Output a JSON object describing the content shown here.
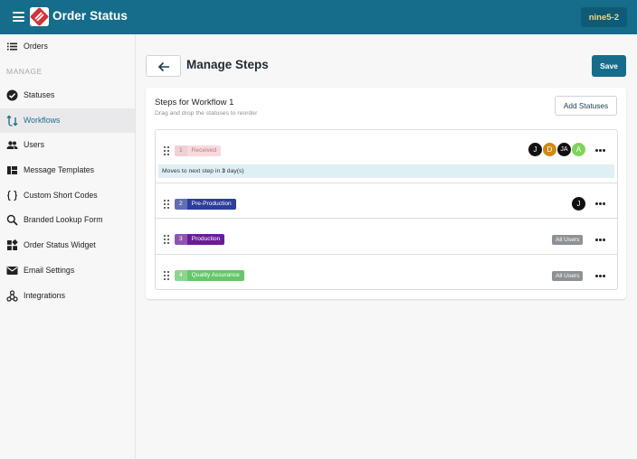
{
  "app": {
    "title": "Order Status",
    "account": "nine5-2"
  },
  "colors": {
    "brand": "#166d8b",
    "accent_red": "#d13438"
  },
  "sidebar": {
    "section_label": "MANAGE",
    "items": [
      {
        "label": "Orders",
        "icon": "list-icon"
      },
      {
        "label": "Statuses",
        "icon": "check-circle-icon"
      },
      {
        "label": "Workflows",
        "icon": "workflow-icon"
      },
      {
        "label": "Users",
        "icon": "users-icon"
      },
      {
        "label": "Message Templates",
        "icon": "template-icon"
      },
      {
        "label": "Custom Short Codes",
        "icon": "braces-icon"
      },
      {
        "label": "Branded Lookup Form",
        "icon": "search-icon"
      },
      {
        "label": "Order Status Widget",
        "icon": "widget-icon"
      },
      {
        "label": "Email Settings",
        "icon": "mail-icon"
      },
      {
        "label": "Integrations",
        "icon": "integrations-icon"
      }
    ],
    "active": "Workflows"
  },
  "page": {
    "title": "Manage Steps",
    "save_label": "Save",
    "back_icon": "arrow-left-icon"
  },
  "card": {
    "title": "Steps for Workflow 1",
    "subtitle": "Drag and drop the statuses to reorder",
    "add_label": "Add Statuses"
  },
  "steps": [
    {
      "num": "1",
      "name": "Received",
      "color": "#f9d9dd",
      "text_color": "#b07b82",
      "avatars": [
        {
          "initial": "J",
          "color": "#111111"
        },
        {
          "initial": "D",
          "color": "#d08a14"
        },
        {
          "initial": "JA",
          "color": "#111111"
        },
        {
          "initial": "A",
          "color": "#7fd35a"
        }
      ],
      "info_prefix": "Moves to next step in ",
      "info_value": "3",
      "info_suffix": " day(s)"
    },
    {
      "num": "2",
      "name": "Pre-Production",
      "color": "#2c3e9a",
      "text_color": "#ffffff",
      "avatars": [
        {
          "initial": "J",
          "color": "#111111"
        }
      ]
    },
    {
      "num": "3",
      "name": "Production",
      "color": "#6a1b9a",
      "text_color": "#ffffff",
      "all_users": "All Users"
    },
    {
      "num": "4",
      "name": "Quality Assurance",
      "color": "#66c76a",
      "text_color": "#ffffff",
      "all_users": "All Users"
    }
  ]
}
